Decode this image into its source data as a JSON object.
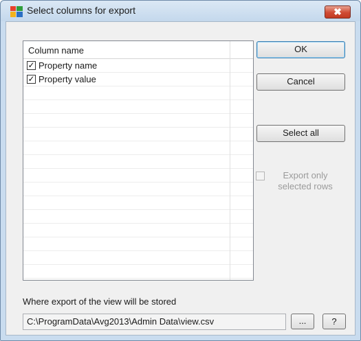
{
  "window": {
    "title": "Select columns for export",
    "close_glyph": "✖"
  },
  "list": {
    "header": "Column name",
    "items": [
      {
        "label": "Property name",
        "checked": true
      },
      {
        "label": "Property value",
        "checked": true
      }
    ]
  },
  "buttons": {
    "ok": "OK",
    "cancel": "Cancel",
    "select_all": "Select all",
    "browse": "...",
    "help": "?"
  },
  "export_only": {
    "label": "Export only selected rows",
    "checked": false,
    "enabled": false
  },
  "storage": {
    "label": "Where export of the view will be stored",
    "path": "C:\\ProgramData\\Avg2013\\Admin Data\\view.csv"
  },
  "icons": {
    "app": "avg-logo-icon",
    "close": "close-icon",
    "checkbox": "checkbox-icon"
  },
  "colors": {
    "close_button": "#cf4b34",
    "title_bar": "#c4d8ec",
    "default_button_border": "#3c7fb1"
  }
}
